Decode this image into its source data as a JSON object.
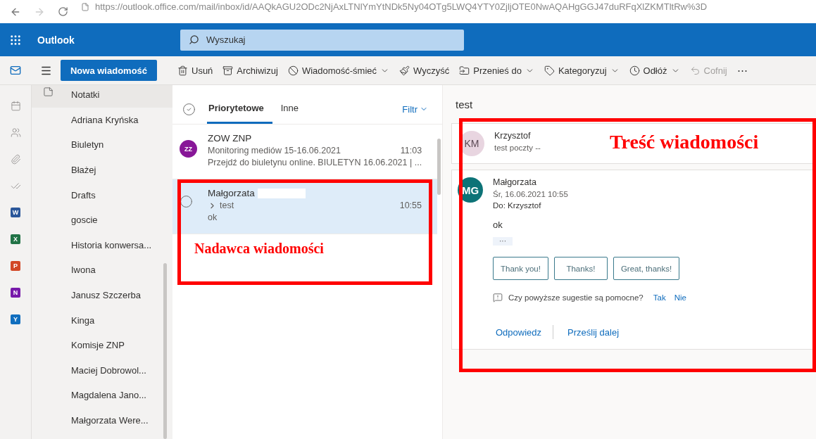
{
  "browser": {
    "url": "https://outlook.office.com/mail/inbox/id/AAQkAGU2ODc2NjAxLTNlYmYtNDk5Ny04OTg5LWQ4YTY0ZjljOTE0NwAQAHgGGJ47duRFqXlZKMTltRw%3D"
  },
  "header": {
    "app_name": "Outlook",
    "search": {
      "placeholder": "Wyszukaj"
    }
  },
  "rail_apps": [
    {
      "letter": "W",
      "color": "#2b579a"
    },
    {
      "letter": "X",
      "color": "#217346"
    },
    {
      "letter": "P",
      "color": "#d24726"
    },
    {
      "letter": "N",
      "color": "#7719aa"
    },
    {
      "letter": "Y",
      "color": "#106ebe"
    }
  ],
  "toolbar": {
    "new_button": "Nowa wiadomość",
    "actions": [
      {
        "kind": "delete",
        "label": "Usuń",
        "dropdown": false,
        "disabled": false
      },
      {
        "kind": "archive",
        "label": "Archiwizuj",
        "dropdown": false,
        "disabled": false
      },
      {
        "kind": "junk",
        "label": "Wiadomość-śmieć",
        "dropdown": true,
        "disabled": false
      },
      {
        "kind": "sweep",
        "label": "Wyczyść",
        "dropdown": false,
        "disabled": false
      },
      {
        "kind": "move",
        "label": "Przenieś do",
        "dropdown": true,
        "disabled": false
      },
      {
        "kind": "categorize",
        "label": "Kategoryzuj",
        "dropdown": true,
        "disabled": false
      },
      {
        "kind": "snooze",
        "label": "Odłóż",
        "dropdown": true,
        "disabled": false
      },
      {
        "kind": "undo",
        "label": "Cofnij",
        "dropdown": false,
        "disabled": true
      }
    ],
    "more": "⋯"
  },
  "folders": [
    {
      "label": "Notatki"
    },
    {
      "label": "Adriana Kryńska"
    },
    {
      "label": "Biuletyn"
    },
    {
      "label": "Błażej"
    },
    {
      "label": "Drafts"
    },
    {
      "label": "goscie"
    },
    {
      "label": "Historia konwersa..."
    },
    {
      "label": "Iwona"
    },
    {
      "label": "Janusz Szczerba"
    },
    {
      "label": "Kinga"
    },
    {
      "label": "Komisje ZNP"
    },
    {
      "label": "Maciej Dobrowol..."
    },
    {
      "label": "Magdalena Jano..."
    },
    {
      "label": "Małgorzata Were..."
    }
  ],
  "message_list": {
    "tabs": [
      {
        "label": "Priorytetowe",
        "selected": true
      },
      {
        "label": "Inne",
        "selected": false
      }
    ],
    "filter": "Filtr",
    "messages": [
      {
        "sender": "ZOW ZNP",
        "initials": "ZZ",
        "color": "#881798",
        "subject": "Monitoring mediów 15-16.06.2021",
        "time": "11:03",
        "preview": "Przejdź do biuletynu online. BIULETYN 16.06.2021 | ...",
        "selected": false,
        "redacted": false,
        "thread": false
      },
      {
        "sender": "Małgorzata",
        "subject": "test",
        "time": "10:55",
        "preview": "ok",
        "selected": true,
        "redacted": true,
        "thread": true
      }
    ]
  },
  "reading_pane": {
    "subject": "test",
    "collapsed": {
      "initials": "KM",
      "sender": "Krzysztof",
      "preview": "test poczty --"
    },
    "message": {
      "initials": "MG",
      "sender": "Małgorzata",
      "date": "Śr, 16.06.2021 10:55",
      "to_label": "Do:",
      "to": "Krzysztof",
      "body": "ok",
      "expand": "···",
      "suggested_replies": [
        "Thank you!",
        "Thanks!",
        "Great, thanks!"
      ],
      "feedback": {
        "question": "Czy powyższe sugestie są pomocne?",
        "yes": "Tak",
        "no": "Nie"
      },
      "actions": [
        "Odpowiedz",
        "Prześlij dalej"
      ]
    }
  },
  "annotations": {
    "sender": "Nadawca wiadomości",
    "content": "Treść wiadomości"
  }
}
